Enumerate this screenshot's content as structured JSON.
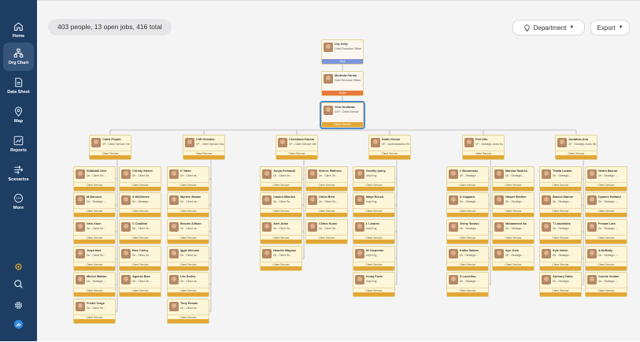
{
  "sidebar": {
    "items": [
      {
        "label": "Home",
        "icon": "home-icon"
      },
      {
        "label": "Org Chart",
        "icon": "org-chart-icon",
        "active": true
      },
      {
        "label": "Data Sheet",
        "icon": "data-sheet-icon"
      },
      {
        "label": "Map",
        "icon": "map-pin-icon"
      },
      {
        "label": "Reports",
        "icon": "reports-icon"
      },
      {
        "label": "Scenarios",
        "icon": "scenarios-icon"
      },
      {
        "label": "More",
        "icon": "more-icon"
      }
    ]
  },
  "toolbar": {
    "summary": "403 people, 13 open jobs, 416 total",
    "department_label": "Department",
    "export_label": "Export"
  },
  "colors": {
    "sidebar_bg": "#1d3d63",
    "card_bg": "#fdf6d8",
    "card_bar": "#e2a735",
    "ceo_bar": "#7c94d8",
    "cro_bar": "#e77a3c",
    "selected_outline": "#4f8ad0"
  },
  "chain": [
    {
      "name": "Lily Kelly",
      "title": "Chief Executive Officer",
      "dept": "G&A"
    },
    {
      "name": "Modesta Parma",
      "title": "Chief Revenue Officer",
      "dept": "Sales"
    },
    {
      "name": "Vera Grubman",
      "title": "SVP - Client Service",
      "dept": "Client Service"
    }
  ],
  "vps": [
    {
      "name": "Caleb Peyala",
      "title": "VP - Client Service Cen...",
      "dept": "Client Service"
    },
    {
      "name": "Cliff Olmsted",
      "title": "VP - Client Service East",
      "dept": "Client Service"
    },
    {
      "name": "Christiana Fausta",
      "title": "VP - Client Service West",
      "dept": "Client Service"
    },
    {
      "name": "Eddie Kimini",
      "title": "VP - Implementation Eng",
      "dept": "Client Service"
    },
    {
      "name": "Phil Ollo",
      "title": "VP - Strategic Accts East",
      "dept": "Client Service"
    },
    {
      "name": "Jonathan Arla",
      "title": "VP - Strategic Accts West",
      "dept": "Client Service"
    }
  ],
  "reports": [
    {
      "left": [
        {
          "name": "Siddhath Devi",
          "title": "Dir - Client Se...",
          "dept": "Client Service"
        },
        {
          "name": "M Bonucci",
          "title": "Dir - Strategic ...",
          "dept": "Client Service"
        },
        {
          "name": "Nels Kaun",
          "title": "Dir - Client Se...",
          "dept": "Client Service"
        },
        {
          "name": "Julya Hart",
          "title": "Dir - Client Se...",
          "dept": "Client Service"
        },
        {
          "name": "Michel Walton",
          "title": "Dir - Strategic ...",
          "dept": "Client Service"
        },
        {
          "name": "Fredel Yorge",
          "title": "Dir - Client Se...",
          "dept": "Client Service"
        }
      ],
      "right": [
        {
          "name": "Christy Stenm",
          "title": "Dir - Client Se...",
          "dept": "Client Service"
        },
        {
          "name": "S McGinnes",
          "title": "Dir - Strategic ...",
          "dept": "Client Service"
        },
        {
          "name": "C Coulibal",
          "title": "Dir - Client Se...",
          "dept": "Client Service"
        },
        {
          "name": "Bice Colley",
          "title": "Dir - Client Se...",
          "dept": "Client Service"
        },
        {
          "name": "Agnese Bice",
          "title": "Dir - Client Se...",
          "dept": "Client Service"
        }
      ]
    },
    {
      "left": [
        {
          "name": "K Yates",
          "title": "Dir - Client se...",
          "dept": "Client Service"
        },
        {
          "name": "Myrtice Meane",
          "title": "Dir - Client se...",
          "dept": "Client Service"
        },
        {
          "name": "Brooke Allison",
          "title": "Dir - Client se...",
          "dept": "Client Service"
        },
        {
          "name": "Iggie Mercani",
          "title": "Dir - Client se...",
          "dept": "Client Service"
        },
        {
          "name": "Lilo Dedric",
          "title": "Dir - Client se...",
          "dept": "Client Service"
        },
        {
          "name": "Tony Rexalo",
          "title": "Dir - Client se...",
          "dept": "Client Service"
        }
      ],
      "right": []
    },
    {
      "left": [
        {
          "name": "Junya Fernandi",
          "title": "Dir - Client Se...",
          "dept": "Client Service"
        },
        {
          "name": "Camira Mikulsn",
          "title": "Dir - Client Se...",
          "dept": "Client Service"
        },
        {
          "name": "Ariel Arlan",
          "title": "Dir - Client Se...",
          "dept": "Client Service"
        },
        {
          "name": "Nanette Magnus",
          "title": "Dir - Client Se...",
          "dept": "Client Service"
        }
      ],
      "right": [
        {
          "name": "Sheree Mathuro",
          "title": "Dir - Client Se...",
          "dept": "Client Service"
        },
        {
          "name": "Ulrica Bren",
          "title": "Dir - Client Se...",
          "dept": "Client Service"
        },
        {
          "name": "Cletus Kume",
          "title": "Dir - Client Se...",
          "dept": "Client Service"
        }
      ]
    },
    {
      "left": [
        {
          "name": "Geoffry Ipony",
          "title": "Impl Eng",
          "dept": "Client Service"
        },
        {
          "name": "Maya Rocca",
          "title": "Impl Eng",
          "dept": "Client Service"
        },
        {
          "name": "L Linares",
          "title": "Impl Eng",
          "dept": "Client Service"
        },
        {
          "name": "W Carpenter",
          "title": "Impl Eng",
          "dept": "Client Service"
        },
        {
          "name": "Irving Forte",
          "title": "Impl Eng",
          "dept": "Client Service"
        }
      ],
      "right": []
    },
    {
      "left": [
        {
          "name": "L Boudreaux",
          "title": "Dir - Strategic ...",
          "dept": "Client Service"
        },
        {
          "name": "D Capparo",
          "title": "Dir - Strategic ...",
          "dept": "Client Service"
        },
        {
          "name": "Ginny Santos",
          "title": "Dir - Strategic ...",
          "dept": "Client Service"
        },
        {
          "name": "Katha Saldos",
          "title": "Dir - Strategic ...",
          "dept": "Client Service"
        },
        {
          "name": "S Lomelino",
          "title": "Dir - Strategic ...",
          "dept": "Client Service"
        }
      ],
      "right": [
        {
          "name": "Marsha Radvck",
          "title": "Dir - Strategic ...",
          "dept": "Client Service"
        },
        {
          "name": "Harper Bottine",
          "title": "Dir - Strategic ...",
          "dept": "Client Service"
        },
        {
          "name": "Mohammed Sa",
          "title": "Dir - Strategic ...",
          "dept": "Client Service"
        },
        {
          "name": "Ayo Julia",
          "title": "Dir - Strategic ...",
          "dept": "Client Service"
        }
      ]
    },
    {
      "left": [
        {
          "name": "Thalia Lardas",
          "title": "Dir - Strategic ...",
          "dept": "Client Service"
        },
        {
          "name": "Bianca Warner",
          "title": "Dir - Strategic ...",
          "dept": "Client Service"
        },
        {
          "name": "T Lanzetakis",
          "title": "Dir - Strategic ...",
          "dept": "Client Service"
        },
        {
          "name": "Kyle Niemi",
          "title": "Dir - Strategic ...",
          "dept": "Client Service"
        },
        {
          "name": "Zachary Fabio",
          "title": "Dir - Strategic ...",
          "dept": "Client Service"
        }
      ],
      "right": [
        {
          "name": "Nedra Barron",
          "title": "Dir - Strategic ...",
          "dept": "Client Service"
        },
        {
          "name": "Dyanne Holland",
          "title": "Dir - Strategic ...",
          "dept": "Client Service"
        },
        {
          "name": "Pesara Lora",
          "title": "Dir - Strategic ...",
          "dept": "Client Service"
        },
        {
          "name": "A McBaily",
          "title": "Dir - Strategic ...",
          "dept": "Client Service"
        },
        {
          "name": "Connie Vedder",
          "title": "Dir - Strategic ...",
          "dept": "Client Service"
        }
      ]
    }
  ]
}
